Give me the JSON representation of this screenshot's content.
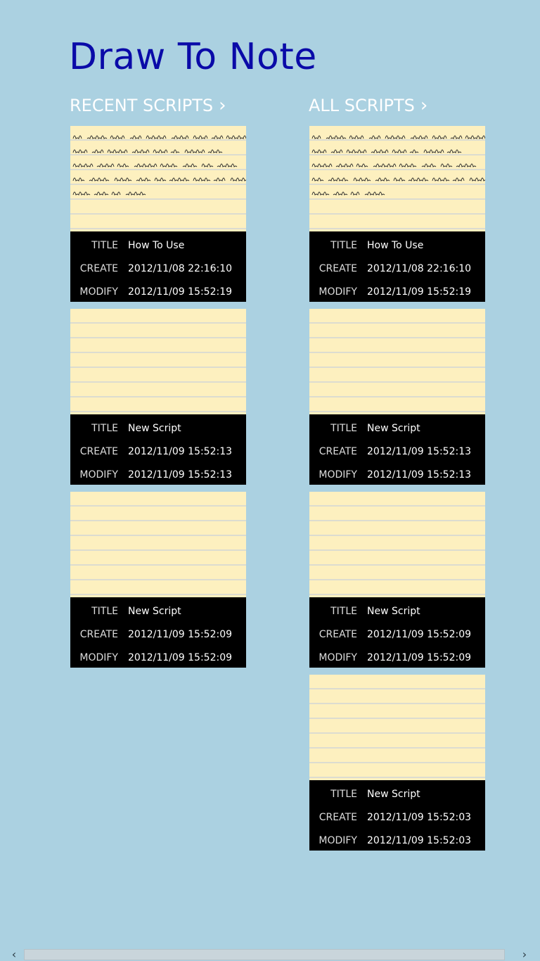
{
  "app": {
    "title": "Draw To Note"
  },
  "groups": {
    "recent": {
      "label": "RECENT SCRIPTS",
      "chevron": "›"
    },
    "all": {
      "label": "ALL SCRIPTS",
      "chevron": "›"
    }
  },
  "labels": {
    "title": "TITLE",
    "create": "CREATE",
    "modify": "MODIFY"
  },
  "recent_scripts": [
    {
      "title": "How To Use",
      "create": "2012/11/08 22:16:10",
      "modify": "2012/11/09 15:52:19",
      "has_handwriting": true
    },
    {
      "title": "New Script",
      "create": "2012/11/09 15:52:13",
      "modify": "2012/11/09 15:52:13",
      "has_handwriting": false
    },
    {
      "title": "New Script",
      "create": "2012/11/09 15:52:09",
      "modify": "2012/11/09 15:52:09",
      "has_handwriting": false
    }
  ],
  "all_scripts": [
    {
      "title": "How To Use",
      "create": "2012/11/08 22:16:10",
      "modify": "2012/11/09 15:52:19",
      "has_handwriting": true
    },
    {
      "title": "New Script",
      "create": "2012/11/09 15:52:13",
      "modify": "2012/11/09 15:52:13",
      "has_handwriting": false
    },
    {
      "title": "New Script",
      "create": "2012/11/09 15:52:09",
      "modify": "2012/11/09 15:52:09",
      "has_handwriting": false
    },
    {
      "title": "New Script",
      "create": "2012/11/09 15:52:03",
      "modify": "2012/11/09 15:52:03",
      "has_handwriting": false
    }
  ],
  "scrollbar": {
    "left_arrow": "‹",
    "right_arrow": "›"
  },
  "icons": {
    "group_chevron": "chevron-right-icon",
    "scroll_left": "scroll-left-icon",
    "scroll_right": "scroll-right-icon"
  },
  "colors": {
    "background": "#abd1e1",
    "title": "#0a0aa8",
    "paper": "#fdf0bf",
    "info_panel": "#000000"
  }
}
